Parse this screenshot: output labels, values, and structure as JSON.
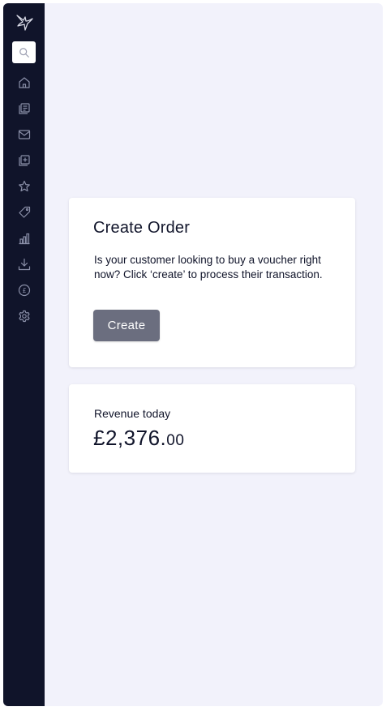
{
  "sidebar": {
    "logo_icon": "hummingbird-icon",
    "search_icon": "search-icon",
    "items": [
      {
        "icon": "home-icon"
      },
      {
        "icon": "orders-icon"
      },
      {
        "icon": "mail-icon"
      },
      {
        "icon": "add-copy-icon"
      },
      {
        "icon": "star-icon"
      },
      {
        "icon": "tag-icon"
      },
      {
        "icon": "bar-chart-icon"
      },
      {
        "icon": "download-icon"
      },
      {
        "icon": "pound-icon"
      },
      {
        "icon": "settings-icon"
      }
    ]
  },
  "create_order": {
    "title": "Create Order",
    "description": "Is your customer looking to buy a voucher right now? Click ‘create’ to process their transaction.",
    "button_label": "Create"
  },
  "revenue": {
    "label": "Revenue today",
    "amount_main": "£2,376.",
    "amount_pence": "00"
  },
  "colors": {
    "sidebar_bg": "#10142a",
    "page_bg": "#f2f2fb",
    "button_bg": "#6b6e7f",
    "icon_color": "#8a8fa8"
  }
}
